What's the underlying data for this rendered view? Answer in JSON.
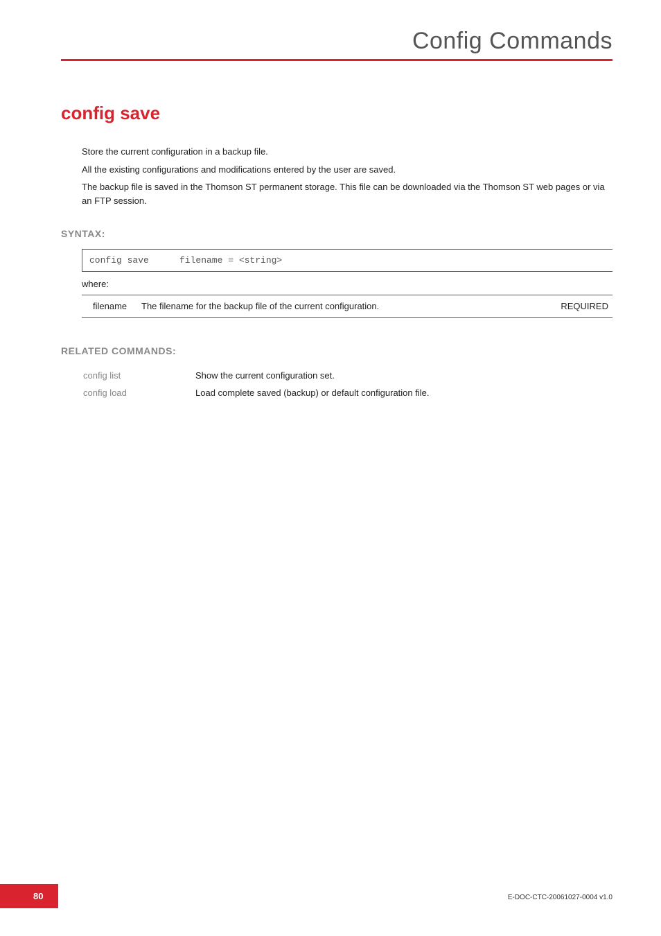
{
  "header": {
    "title": "Config Commands"
  },
  "command": {
    "title": "config save",
    "description": [
      "Store the current configuration in a backup file.",
      "All the existing configurations and modifications entered by the user are saved.",
      "The backup file is saved in the Thomson ST permanent storage. This file can be downloaded via the Thomson ST web pages or via an FTP session."
    ]
  },
  "syntax": {
    "label": "SYNTAX:",
    "command": "config save",
    "args": "filename = <string>",
    "where": "where:",
    "params": [
      {
        "name": "filename",
        "desc": "The filename for the backup file of the current configuration.",
        "req": "REQUIRED"
      }
    ]
  },
  "related": {
    "label": "RELATED COMMANDS:",
    "rows": [
      {
        "cmd": "config list",
        "desc": "Show the current configuration set."
      },
      {
        "cmd": "config load",
        "desc": "Load complete saved (backup) or default configuration file."
      }
    ]
  },
  "footer": {
    "page": "80",
    "docid": "E-DOC-CTC-20061027-0004 v1.0"
  }
}
